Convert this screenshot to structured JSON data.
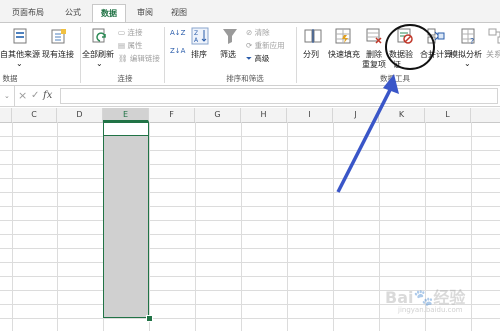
{
  "tabs": [
    {
      "label": "页面布局",
      "active": false
    },
    {
      "label": "公式",
      "active": false
    },
    {
      "label": "数据",
      "active": true
    },
    {
      "label": "审阅",
      "active": false
    },
    {
      "label": "视图",
      "active": false
    }
  ],
  "ribbon": {
    "get_data": {
      "from_other_sources": "自其他来源",
      "existing_connections": "现有连接",
      "group_label": "数据"
    },
    "connections": {
      "refresh_all": "全部刷新",
      "connections": "连接",
      "properties": "属性",
      "edit_links": "编辑链接",
      "group_label": "连接"
    },
    "sort_filter": {
      "sort_asc": "A↓Z",
      "sort_desc": "Z↓A",
      "sort": "排序",
      "filter": "筛选",
      "clear": "清除",
      "reapply": "重新应用",
      "advanced": "高级",
      "group_label": "排序和筛选"
    },
    "data_tools": {
      "text_to_columns": "分列",
      "flash_fill": "快速填充",
      "remove_duplicates": "删除",
      "remove_duplicates_2": "重复项",
      "data_validation": "数据验",
      "data_validation_2": "证",
      "consolidate": "合并计算",
      "what_if": "模拟分析",
      "group_label": "数据工具"
    },
    "relationships": "关系"
  },
  "formula_bar": {
    "cancel": "×",
    "enter": "✓",
    "fx": "fx",
    "value": ""
  },
  "columns": [
    "C",
    "D",
    "E",
    "F",
    "G",
    "H",
    "I",
    "J",
    "K",
    "L"
  ],
  "selected_column": "E",
  "watermark": {
    "brand": "Bai",
    "text": "经验",
    "url": "jingyan.baidu.com"
  },
  "accent": "#217346",
  "annotation_color": "#3a56c8"
}
